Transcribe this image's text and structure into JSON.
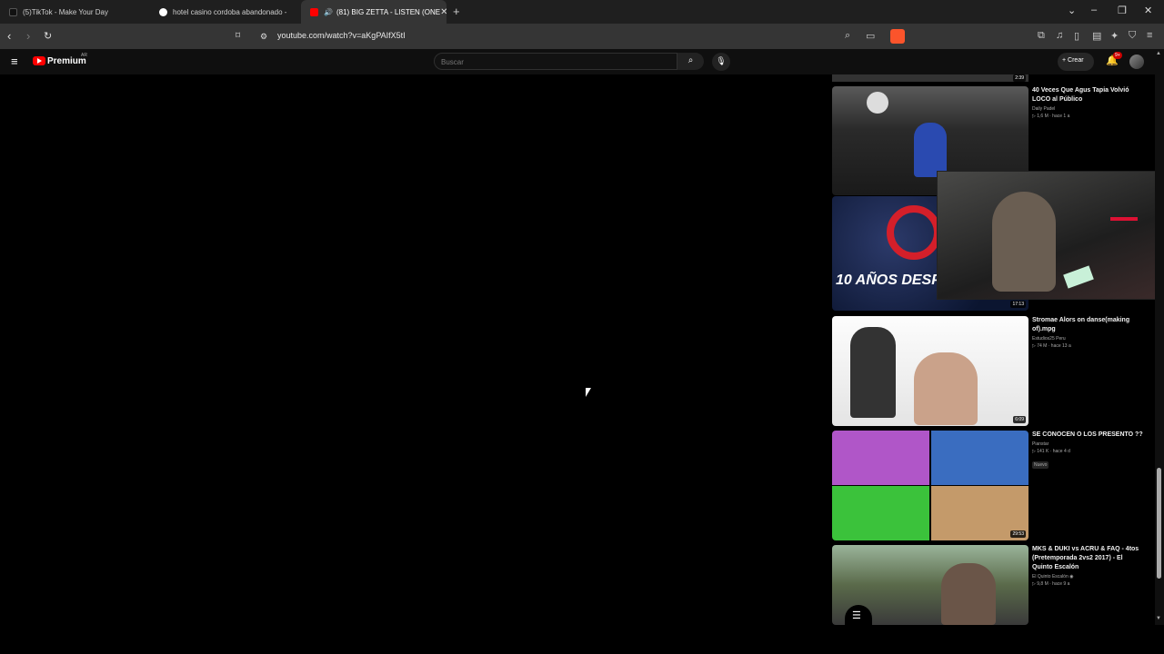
{
  "browser": {
    "tabs": [
      {
        "label": "(5)TikTok - Make Your Day",
        "active": false
      },
      {
        "label": "hotel casino cordoba abandonado - ",
        "active": false
      },
      {
        "label": "(81) BIG ZETTA - LISTEN (ONE",
        "active": true
      }
    ],
    "url": "youtube.com/watch?v=aKgPAIfX5tI"
  },
  "youtube": {
    "logo_text": "Premium",
    "region": "AR",
    "search_placeholder": "Buscar",
    "create_label": "Crear",
    "notifications": "9+"
  },
  "recommendations": [
    {
      "title": "40 Veces Que Agus Tapia Volvió LOCO al Público",
      "channel": "Daily Padel",
      "stats": "▷ 1,6 M · hace 1 a",
      "duration": ""
    },
    {
      "title": "",
      "channel": "",
      "stats": "",
      "duration": "17:13",
      "overlay_text": "10 AÑOS DESPUES..."
    },
    {
      "title": "Stromae  Alors on danse(making of).mpg",
      "channel": "Estudios25 Peru",
      "stats": "▷ 74 M · hace 13 a",
      "duration": "6:09"
    },
    {
      "title": "SE CONOCEN O LOS PRESENTO ??",
      "channel": "Pianstar",
      "stats": "▷ 141 K · hace 4 d",
      "badge": "Nuevo",
      "duration": "29:53"
    },
    {
      "title": "MKS & DUKI vs ACRU & FAQ - 4tos (Pretemporada 2vs2 2017) - El Quinto Escalón",
      "channel": "El Quinto Escalón ◉",
      "stats": "▷ 9,8 M · hace 9 a",
      "duration": ""
    }
  ],
  "top_partial_duration": "2:39"
}
